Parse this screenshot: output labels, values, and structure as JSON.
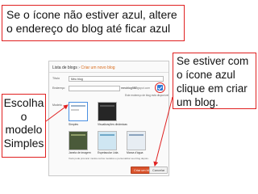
{
  "callouts": {
    "top": "Se o ícone não estiver azul, altere o endereço do blog até ficar azul",
    "right": "Se estiver com o ícone azul clique em criar um blog.",
    "left": "Escolha o modelo Simples"
  },
  "dialog": {
    "breadcrumb_parent": "Lista de blogs",
    "breadcrumb_sep": "›",
    "breadcrumb_current": "Criar um novo blog",
    "title_label": "Título",
    "title_value": "Meu blog",
    "address_label": "Endereço",
    "address_value": "meublog987",
    "address_suffix": ".blogspot.com",
    "availability_message": "Este endereço de blog está disponível.",
    "templates_label": "Modelo",
    "templates": [
      {
        "name": "Simples"
      },
      {
        "name": "Visualizações dinâmicas"
      },
      {
        "name": "Janela de imagem"
      },
      {
        "name": "Espetacular Ltda."
      },
      {
        "name": "Marca d'água"
      }
    ],
    "footer_note": "Você pode procurar muitos outros modelos e personalizar seu blog depois.",
    "create_button": "Criar um blog!",
    "cancel_button": "Cancelar"
  },
  "colors": {
    "callout_border": "#e02020",
    "availability_icon": "#2f78d6",
    "create_button": "#d9532c",
    "breadcrumb_new": "#d86a1a"
  }
}
